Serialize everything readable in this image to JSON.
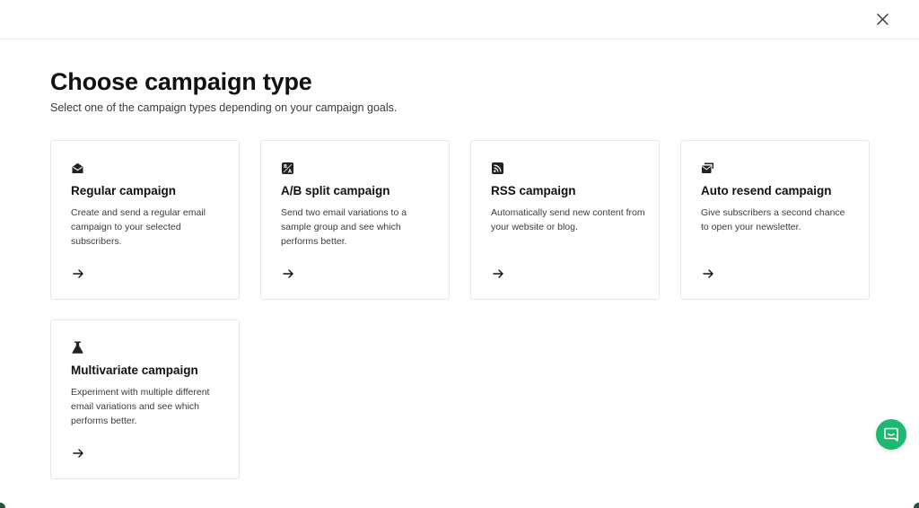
{
  "header": {
    "close_icon": "close-icon"
  },
  "main": {
    "title": "Choose campaign type",
    "subtitle": "Select one of the campaign types depending on your campaign goals."
  },
  "campaigns": [
    {
      "icon": "envelope-open-icon",
      "title": "Regular campaign",
      "description": "Create and send a regular email campaign to your selected subscribers."
    },
    {
      "icon": "split-test-icon",
      "title": "A/B split campaign",
      "description": "Send two email variations to a sample group and see which performs better."
    },
    {
      "icon": "rss-icon",
      "title": "RSS campaign",
      "description": "Automatically send new content from your website or blog."
    },
    {
      "icon": "resend-mail-icon",
      "title": "Auto resend campaign",
      "description": "Give subscribers a second chance to open your newsletter."
    },
    {
      "icon": "flask-icon",
      "title": "Multivariate campaign",
      "description": "Experiment with multiple different email variations and see which performs better."
    }
  ],
  "support": {
    "chat_icon": "chat-icon",
    "accent_color": "#1fb871"
  }
}
